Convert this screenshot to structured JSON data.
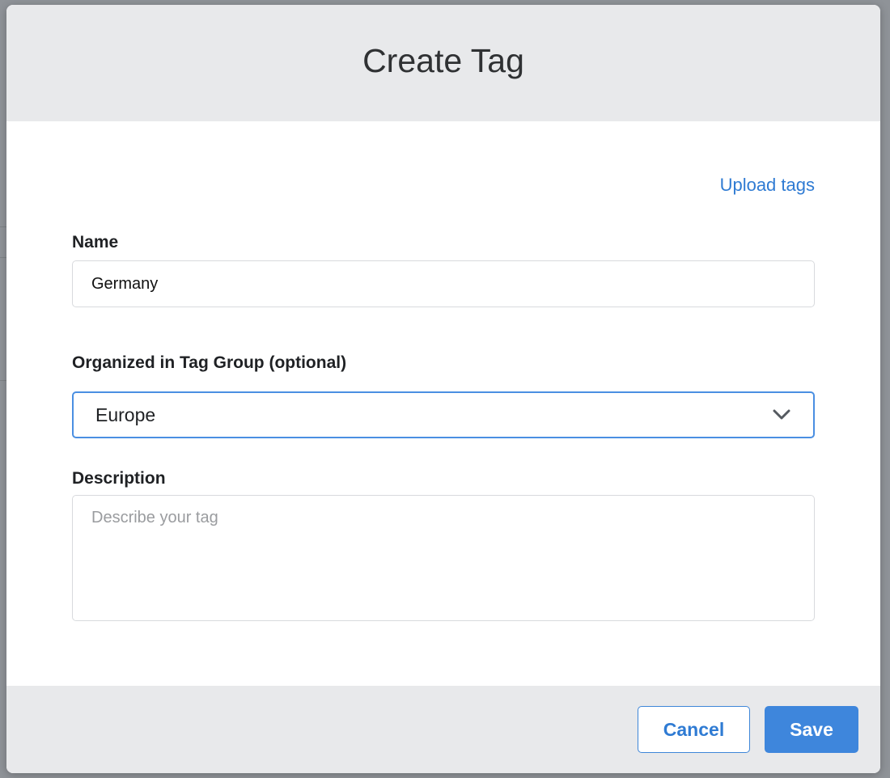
{
  "dialog": {
    "title": "Create Tag",
    "upload_link": "Upload tags"
  },
  "name_field": {
    "label": "Name",
    "value": "Germany"
  },
  "tag_group_field": {
    "label": "Organized in Tag Group (optional)",
    "selected": "Europe",
    "icon": "chevron-down-icon"
  },
  "description_field": {
    "label": "Description",
    "value": "",
    "placeholder": "Describe your tag"
  },
  "footer": {
    "cancel_label": "Cancel",
    "save_label": "Save"
  },
  "colors": {
    "accent": "#3e86dc",
    "link": "#2f7bd3",
    "header_bg": "#e8e9eb",
    "focus_border": "#4a8fe2"
  }
}
